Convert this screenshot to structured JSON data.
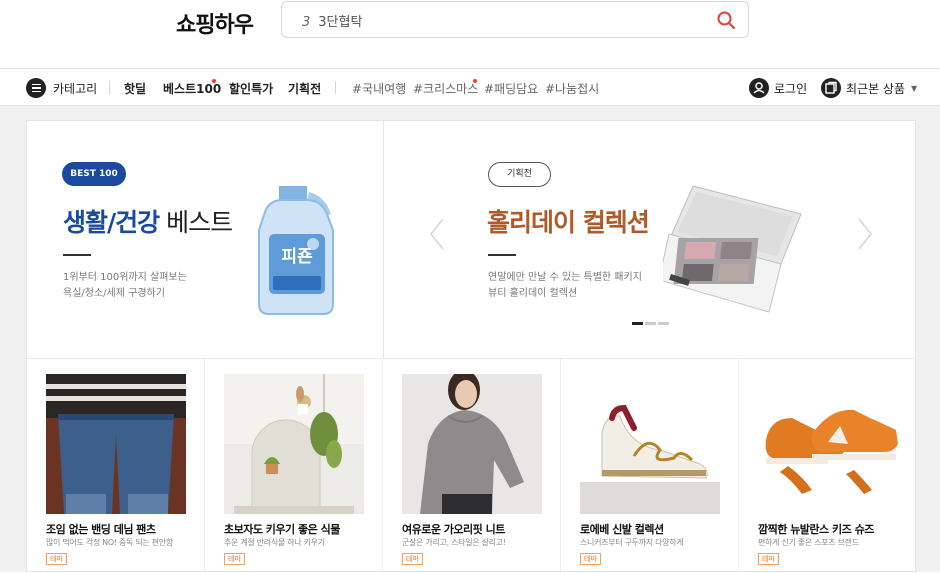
{
  "header": {
    "logo": "쇼핑하우",
    "search": {
      "rank": "3",
      "keyword": "3단협탁"
    }
  },
  "nav": {
    "category_label": "카테고리",
    "items": [
      "핫딜",
      "베스트100",
      "할인특가",
      "기획전"
    ],
    "tags": [
      "#국내여행",
      "#크리스마스",
      "#패딩담요",
      "#나눔접시"
    ],
    "login_label": "로그인",
    "recent_label": "최근본 상품",
    "accent_color": "#e8413b"
  },
  "banners": {
    "left": {
      "badge": "BEST 100",
      "title_highlight": "생활/건강",
      "title_rest": "베스트",
      "desc_line1": "1위부터 100위까지 살펴보는",
      "desc_line2": "욕실/청소/세제 구경하기",
      "product_label": "피죤",
      "color": "#1a4a9e"
    },
    "right": {
      "badge": "기획전",
      "title": "홀리데이 컬렉션",
      "desc_line1": "연말에만 만날 수 있는 특별한 패키지",
      "desc_line2": "뷰티 홀리데이 컬렉션",
      "color": "#b05a2a"
    }
  },
  "products": [
    {
      "title": "조임 없는 밴딩 데님 팬츠",
      "subtitle": "많이 먹어도 걱정 NO! 중독 되는 편안함",
      "badge": "테마"
    },
    {
      "title": "초보자도 키우기 좋은 식물",
      "subtitle": "추운 계절 반려식물 하나 키우기",
      "badge": "테마"
    },
    {
      "title": "여유로운 가오리핏 니트",
      "subtitle": "군살은 가리고, 스타일은 살리고!",
      "badge": "테마"
    },
    {
      "title": "로에베 신발 컬렉션",
      "subtitle": "스니커즈부터 구두까지 다양하게",
      "badge": "테마"
    },
    {
      "title": "깜찍한 뉴발란스 키즈 슈즈",
      "subtitle": "편하게 신기 좋은 스포츠 브랜드",
      "badge": "테마"
    }
  ]
}
